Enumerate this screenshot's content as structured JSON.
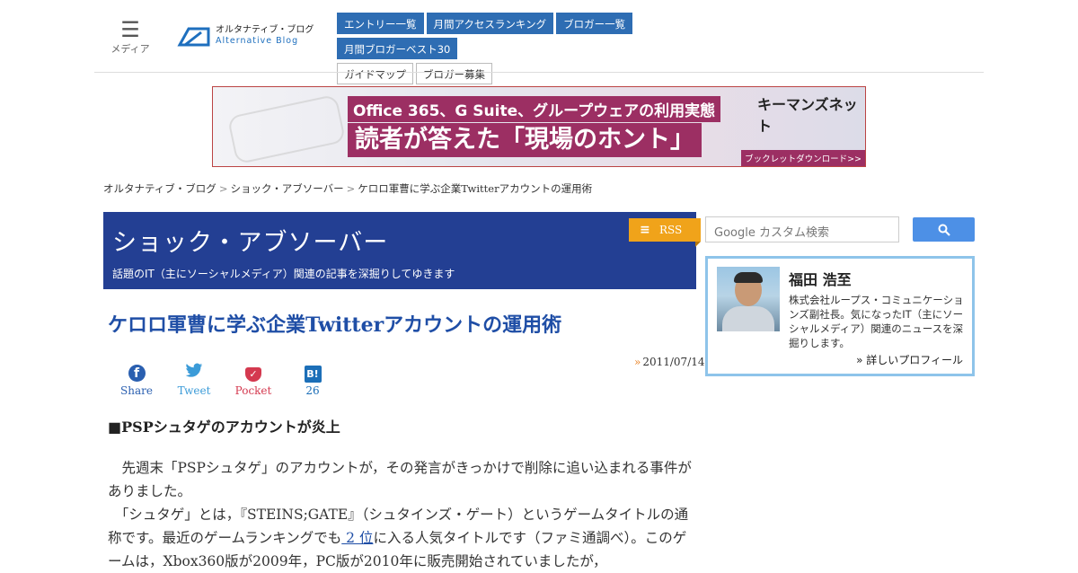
{
  "header": {
    "menu_label": "メディア",
    "logo_jp": "オルタナティブ・ブログ",
    "logo_en": "Alternative Blog",
    "nav_primary": [
      "エントリー一覧",
      "月間アクセスランキング",
      "ブロガー一覧",
      "月間ブロガーベスト30"
    ],
    "nav_secondary": [
      "ガイドマップ",
      "ブロガー募集"
    ]
  },
  "banner": {
    "line1": "Office 365、G Suite、グループウェアの利用実態",
    "line2": "読者が答えた「現場のホント」",
    "brand": "キーマンズネット",
    "cta": "ブックレットダウンロード>>"
  },
  "breadcrumb": [
    "オルタナティブ・ブログ",
    "ショック・アブソーバー",
    "ケロロ軍曹に学ぶ企業Twitterアカウントの運用術"
  ],
  "blog": {
    "title": "ショック・アブソーバー",
    "subtitle": "話題のIT（主にソーシャルメディア）関連の記事を深掘りしてゆきます",
    "rss_label": "RSS"
  },
  "article": {
    "title": "ケロロ軍曹に学ぶ企業Twitterアカウントの運用術",
    "date_marker": "»",
    "date": "2011/07/14",
    "share": {
      "facebook": "Share",
      "twitter": "Tweet",
      "pocket": "Pocket",
      "hatena": "26"
    },
    "section_heading": "■PSPシュタゲのアカウントが炎上",
    "paragraph1": "　先週末「PSPシュタゲ」のアカウントが，その発言がきっかけで削除に追い込まれる事件がありました。",
    "paragraph2_before": "　「シュタゲ」とは，『STEINS;GATE』（シュタインズ・ゲート）というゲームタイトルの通称です。最近のゲームランキングでも",
    "paragraph2_link": " 2 位",
    "paragraph2_after": "に入る人気タイトルです（ファミ通調べ）。このゲームは，Xbox360版が2009年，PC版が2010年に販売開始されていましたが，"
  },
  "sidebar": {
    "search_placeholder": "Google カスタム検索",
    "profile": {
      "name": "福田 浩至",
      "bio": "株式会社ループス・コミュニケーションズ副社長。気になったIT（主にソーシャルメディア）関連のニュースを深掘りします。",
      "more": "» 詳しいプロフィール"
    }
  },
  "colors": {
    "nav_blue": "#2e6db3",
    "blog_header": "#233f93",
    "title_blue": "#1f4ea6",
    "rss_orange": "#f0a31a",
    "profile_border": "#8ec4ea"
  }
}
